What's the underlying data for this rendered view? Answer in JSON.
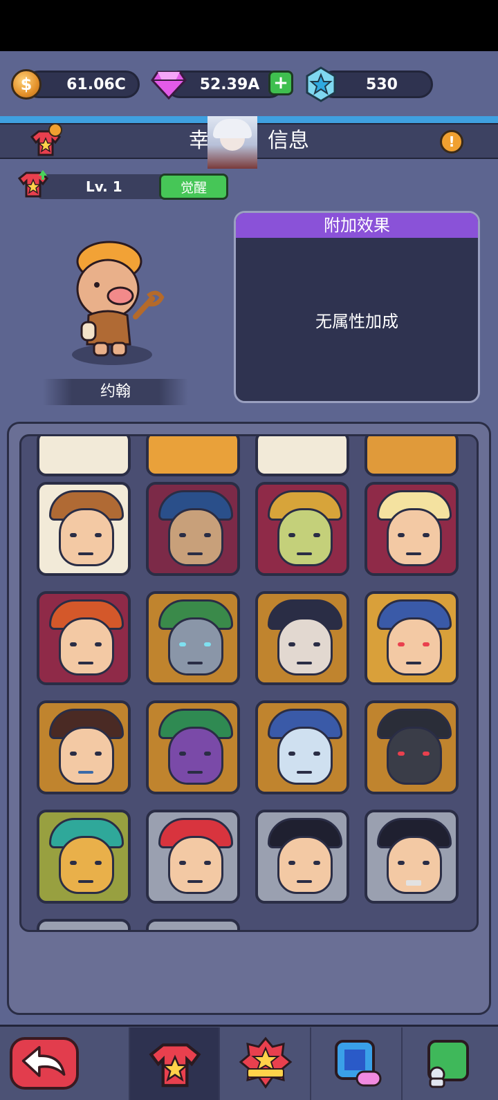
{
  "currencies": {
    "coins": "61.06C",
    "gems": "52.39A",
    "energy": "530"
  },
  "header": {
    "title_left": "幸",
    "title_right": "信息",
    "info_glyph": "!"
  },
  "level": {
    "label": "Lv. 1",
    "awaken_button": "觉醒"
  },
  "hero": {
    "name": "约翰"
  },
  "bonus": {
    "header": "附加效果",
    "text": "无属性加成"
  },
  "grid": {
    "card_colors": [
      "#a6325a",
      "#e09a3a",
      "#9aa8c0",
      "#f2ead8",
      "#7c2a48",
      "#c0842e",
      "#8f2a48",
      "#d9a03a"
    ]
  },
  "colors": {
    "background": "#5d6590",
    "accent_blue": "#3fa0e0",
    "purple_header": "#8a52d8",
    "green_button": "#46c657",
    "red_back": "#e23d4d"
  },
  "icons": {
    "coin": "coin-icon",
    "gem": "gem-icon",
    "energy": "star-icon",
    "back": "back-arrow-icon",
    "tab_shirt": "shirt-icon",
    "tab_badge": "badge-icon",
    "tab_gamepad": "gamepad-icon",
    "tab_profile": "profile-icon"
  }
}
